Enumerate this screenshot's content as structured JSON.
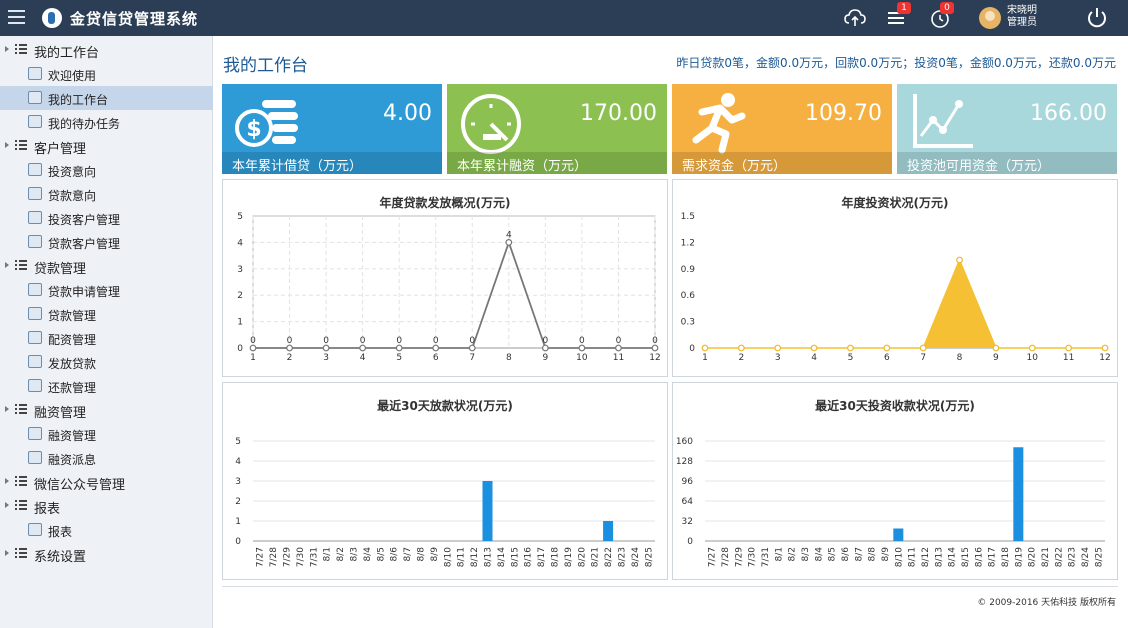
{
  "app": {
    "title": "金贷信贷管理系统"
  },
  "topbar": {
    "icons": [
      "menu-icon",
      "cloud-upload-icon",
      "list-icon",
      "clock-icon",
      "power-icon"
    ],
    "messages_badge": "1",
    "reminders_badge": "0",
    "user_name": "宋晓明",
    "user_role": "管理员"
  },
  "sidebar": {
    "groups": [
      {
        "label": "我的工作台",
        "items": [
          {
            "label": "欢迎使用",
            "icon": "home-icon"
          },
          {
            "label": "我的工作台",
            "icon": "monitor-icon",
            "active": true
          },
          {
            "label": "我的待办任务",
            "icon": "checklist-icon"
          }
        ]
      },
      {
        "label": "客户管理",
        "items": [
          {
            "label": "投资意向",
            "icon": "table-icon"
          },
          {
            "label": "贷款意向",
            "icon": "table-icon"
          },
          {
            "label": "投资客户管理",
            "icon": "users-icon"
          },
          {
            "label": "贷款客户管理",
            "icon": "users-icon"
          }
        ]
      },
      {
        "label": "贷款管理",
        "items": [
          {
            "label": "贷款申请管理",
            "icon": "edit-icon"
          },
          {
            "label": "贷款管理",
            "icon": "document-icon"
          },
          {
            "label": "配资管理",
            "icon": "document-icon"
          },
          {
            "label": "发放贷款",
            "icon": "document-icon"
          },
          {
            "label": "还款管理",
            "icon": "document-icon"
          }
        ]
      },
      {
        "label": "融资管理",
        "items": [
          {
            "label": "融资管理",
            "icon": "document-icon"
          },
          {
            "label": "融资派息",
            "icon": "exchange-icon"
          }
        ]
      },
      {
        "label": "微信公众号管理",
        "items": []
      },
      {
        "label": "报表",
        "items": [
          {
            "label": "报表",
            "icon": "report-icon"
          }
        ]
      },
      {
        "label": "系统设置",
        "items": []
      }
    ]
  },
  "main": {
    "page_title": "我的工作台",
    "summary": "昨日贷款0笔，金额0.0万元，回款0.0万元；投资0笔，金额0.0万元，还款0.0万元"
  },
  "cards": [
    {
      "value": "4.00",
      "label": "本年累计借贷（万元）",
      "color": "#2e9bd6",
      "icon": "coins-icon"
    },
    {
      "value": "170.00",
      "label": "本年累计融资（万元）",
      "color": "#8cc152",
      "icon": "speedometer-icon"
    },
    {
      "value": "109.70",
      "label": "需求资金（万元）",
      "color": "#f6b042",
      "icon": "runner-icon"
    },
    {
      "value": "166.00",
      "label": "投资池可用资金（万元）",
      "color": "#a8d8dc",
      "icon": "line-chart-icon"
    }
  ],
  "chart_data": [
    {
      "type": "line",
      "title": "年度贷款发放概况(万元)",
      "x": [
        "1",
        "2",
        "3",
        "4",
        "5",
        "6",
        "7",
        "8",
        "9",
        "10",
        "11",
        "12"
      ],
      "values": [
        0,
        0,
        0,
        0,
        0,
        0,
        0,
        4,
        0,
        0,
        0,
        0
      ],
      "ylim": [
        0,
        5
      ],
      "yticks": [
        "0",
        "1",
        "2",
        "3",
        "4",
        "5"
      ],
      "grid": true,
      "color": "#777777"
    },
    {
      "type": "area",
      "title": "年度投资状况(万元)",
      "x": [
        "1",
        "2",
        "3",
        "4",
        "5",
        "6",
        "7",
        "8",
        "9",
        "10",
        "11",
        "12"
      ],
      "values": [
        0,
        0,
        0,
        0,
        0,
        0,
        0,
        1,
        0,
        0,
        0,
        0
      ],
      "ylim": [
        0,
        1.5
      ],
      "yticks": [
        "0",
        "0.3",
        "0.6",
        "0.9",
        "1.2",
        "1.5"
      ],
      "grid": false,
      "color": "#f6c035"
    },
    {
      "type": "bar",
      "title": "最近30天放款状况(万元)",
      "categories": [
        "7/27",
        "7/28",
        "7/29",
        "7/30",
        "7/31",
        "8/1",
        "8/2",
        "8/3",
        "8/4",
        "8/5",
        "8/6",
        "8/7",
        "8/8",
        "8/9",
        "8/10",
        "8/11",
        "8/12",
        "8/13",
        "8/14",
        "8/15",
        "8/16",
        "8/17",
        "8/18",
        "8/19",
        "8/20",
        "8/21",
        "8/22",
        "8/23",
        "8/24",
        "8/25"
      ],
      "values": [
        0,
        0,
        0,
        0,
        0,
        0,
        0,
        0,
        0,
        0,
        0,
        0,
        0,
        0,
        0,
        0,
        0,
        3,
        0,
        0,
        0,
        0,
        0,
        0,
        0,
        0,
        1,
        0,
        0,
        0
      ],
      "ylim": [
        0,
        5
      ],
      "yticks": [
        "0",
        "1",
        "2",
        "3",
        "4",
        "5"
      ],
      "color": "#1b8fe0"
    },
    {
      "type": "bar",
      "title": "最近30天投资收款状况(万元)",
      "categories": [
        "7/27",
        "7/28",
        "7/29",
        "7/30",
        "7/31",
        "8/1",
        "8/2",
        "8/3",
        "8/4",
        "8/5",
        "8/6",
        "8/7",
        "8/8",
        "8/9",
        "8/10",
        "8/11",
        "8/12",
        "8/13",
        "8/14",
        "8/15",
        "8/16",
        "8/17",
        "8/18",
        "8/19",
        "8/20",
        "8/21",
        "8/22",
        "8/23",
        "8/24",
        "8/25"
      ],
      "values": [
        0,
        0,
        0,
        0,
        0,
        0,
        0,
        0,
        0,
        0,
        0,
        0,
        0,
        0,
        20,
        0,
        0,
        0,
        0,
        0,
        0,
        0,
        0,
        150,
        0,
        0,
        0,
        0,
        0,
        0
      ],
      "ylim": [
        0,
        160
      ],
      "yticks": [
        "0",
        "32",
        "64",
        "96",
        "128",
        "160"
      ],
      "color": "#1b8fe0"
    }
  ],
  "footer": {
    "copyright": "© 2009-2016 天佑科技 版权所有"
  }
}
